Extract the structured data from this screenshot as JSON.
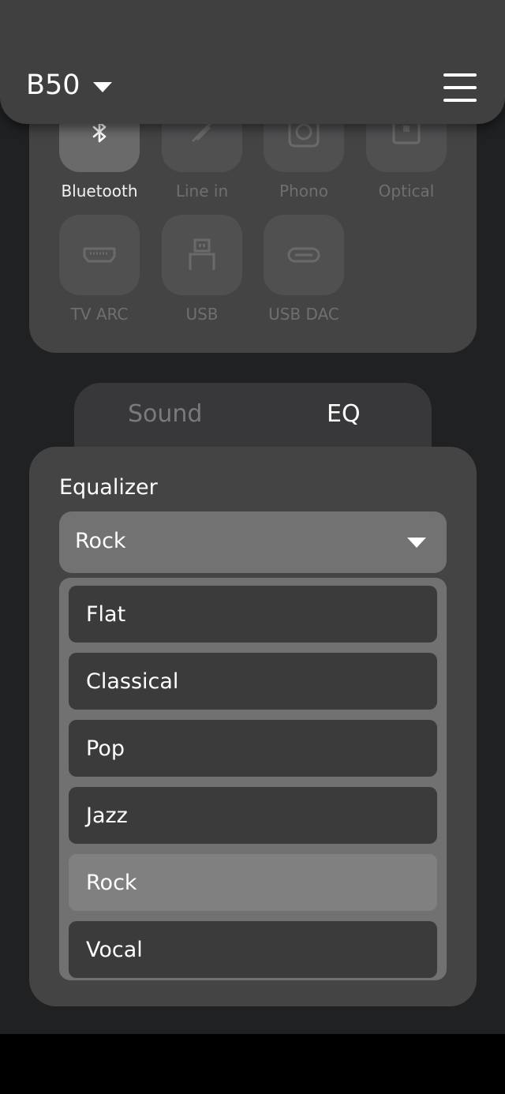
{
  "header": {
    "device_name": "B50",
    "device_dropdown_icon": "caret-down-icon",
    "menu_icon": "hamburger-menu-icon"
  },
  "sources": [
    {
      "label": "Bluetooth",
      "icon": "bluetooth-icon",
      "active": true
    },
    {
      "label": "Line in",
      "icon": "line-in-icon",
      "active": false
    },
    {
      "label": "Phono",
      "icon": "phono-icon",
      "active": false
    },
    {
      "label": "Optical",
      "icon": "optical-icon",
      "active": false
    },
    {
      "label": "TV ARC",
      "icon": "hdmi-icon",
      "active": false
    },
    {
      "label": "USB",
      "icon": "usb-icon",
      "active": false
    },
    {
      "label": "USB DAC",
      "icon": "usb-c-icon",
      "active": false
    }
  ],
  "tabs": [
    {
      "label": "Sound",
      "active": false
    },
    {
      "label": "EQ",
      "active": true
    }
  ],
  "equalizer": {
    "title": "Equalizer",
    "selected": "Rock",
    "options": [
      "Flat",
      "Classical",
      "Pop",
      "Jazz",
      "Rock",
      "Vocal"
    ]
  },
  "colors": {
    "background": "#202123",
    "card": "#444445",
    "header": "#404041",
    "selected_option": "#808081",
    "text": "#ffffff",
    "muted_text": "#6f6f70"
  }
}
